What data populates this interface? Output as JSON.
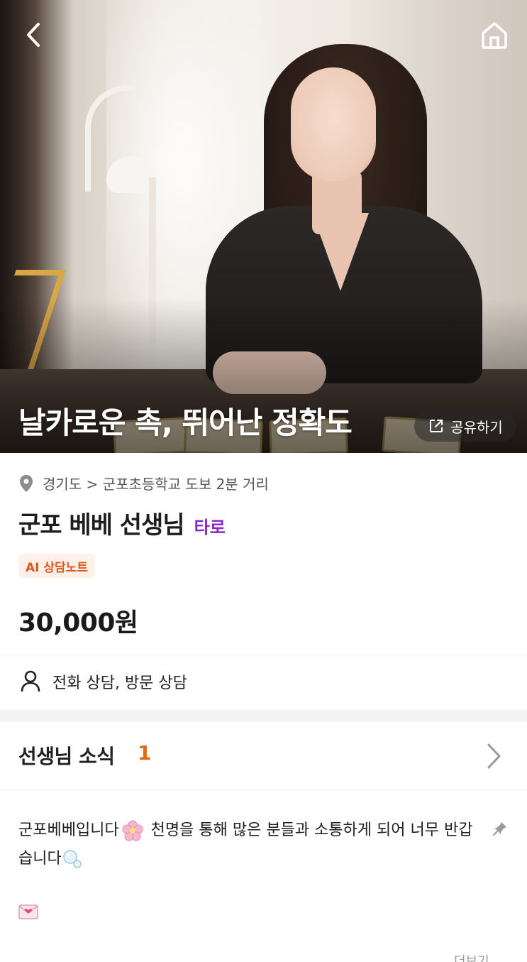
{
  "hero": {
    "title": "날카로운 촉, 뛰어난 정확도",
    "share_label": "공유하기"
  },
  "profile": {
    "location": "경기도 > 군포초등학교 도보 2분 거리",
    "name": "군포 베베 선생님",
    "category": "타로",
    "ai_badge": "AI 상담노트",
    "price": "30,000원",
    "consult_types": "전화 상담, 방문 상담"
  },
  "news": {
    "title": "선생님 소식",
    "count": "1",
    "text_part1": "군포베베입니다",
    "text_part2": " 천명을 통해 많은 분들과 소통하게 되어 너무 반갑습니다",
    "more_label": "더보기"
  },
  "colors": {
    "category": "#8a26c4",
    "accent_orange": "#e06a1b",
    "badge_bg": "#fff0e8",
    "badge_text": "#e2571f"
  },
  "icons": [
    "back-arrow-icon",
    "home-icon",
    "share-icon",
    "location-pin-icon",
    "person-icon",
    "chevron-right-icon",
    "pin-icon",
    "cherry-blossom-icon",
    "bubbles-icon",
    "love-letter-icon"
  ]
}
